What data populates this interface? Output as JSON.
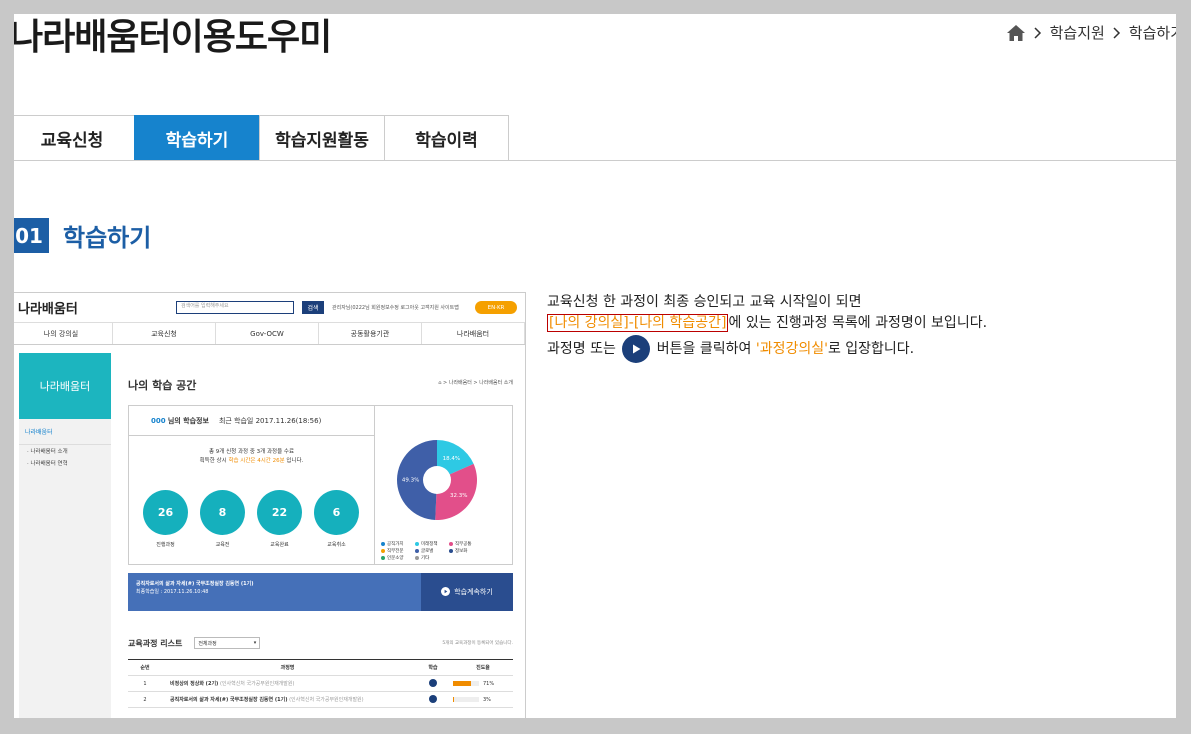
{
  "page_title": "나라배움터이용도우미",
  "breadcrumb": [
    "학습지원",
    "학습하기"
  ],
  "tabs": [
    {
      "label": "교육신청",
      "active": false
    },
    {
      "label": "학습하기",
      "active": true
    },
    {
      "label": "학습지원활동",
      "active": false
    },
    {
      "label": "학습이력",
      "active": false
    }
  ],
  "section": {
    "number": "01",
    "title": "학습하기"
  },
  "description": {
    "line1": "교육신청 한 과정이 최종 승인되고 교육 시작일이 되면",
    "line2_highlight": "[나의 강의실]-[나의 학습공간]",
    "line2_rest": "에 있는 진행과정 목록에 과정명이 보입니다.",
    "line3_a": "과정명 또는",
    "line3_b": "버튼을 클릭하여",
    "line3_highlight": "'과정강의실'",
    "line3_c": "로 입장합니다."
  },
  "shot": {
    "logo": "나라배움터",
    "search_placeholder": "검색어를 입력해주세요",
    "search_button": "검색",
    "top_links": "관리자님(0222님 회원정보수정 로그아웃 고객지원 사이트맵",
    "en_button": "EN·KR",
    "gnb": [
      "나의 강의실",
      "교육신청",
      "Gov-OCW",
      "공동활용기관",
      "나라배움터"
    ],
    "side_head": "나라배움터",
    "side_item": "나라배움터",
    "side_subs": [
      "· 나라배움터 소개",
      "· 나라배움터 연혁"
    ],
    "heading": "나의 학습 공간",
    "breadcrumb": "⌂ > 나라배움터 > 나라배움터 소개",
    "info_name": "000",
    "info_title": "님의 학습정보",
    "info_last": "최근 학습일 2017.11.26(18:56)",
    "summary1": "총 9개 신청 과정 중 3개 과정을 수료",
    "summary2a": "획득한 상시",
    "summary2b": "학습 시간은 4시간 26분",
    "summary2c": "입니다.",
    "circles": [
      {
        "value": "26",
        "label": "진행과정"
      },
      {
        "value": "8",
        "label": "교육전"
      },
      {
        "value": "22",
        "label": "교육완료"
      },
      {
        "value": "6",
        "label": "교육취소"
      }
    ],
    "pie": [
      {
        "label": "49.3%",
        "value": 49.3,
        "color": "#3f5fa8"
      },
      {
        "label": "32.3%",
        "value": 32.3,
        "color": "#e24f8a"
      },
      {
        "label": "18.4%",
        "value": 18.4,
        "color": "#2ec9e4"
      }
    ],
    "legend": [
      {
        "label": "공직가치",
        "color": "#1683cd"
      },
      {
        "label": "미래정책",
        "color": "#2ec9e4"
      },
      {
        "label": "직무공통",
        "color": "#e24f8a"
      },
      {
        "label": "직무전문",
        "color": "#f5a000"
      },
      {
        "label": "글로벌",
        "color": "#3f5fa8"
      },
      {
        "label": "정보화",
        "color": "#2a4d8f"
      },
      {
        "label": "인문소양",
        "color": "#29a36a"
      },
      {
        "label": "기타",
        "color": "#999999"
      }
    ],
    "bar_title": "공직자로서의 삶과 자세(#) 국무조정실장 김동연 (1기)",
    "bar_sub": "최종학습일 : 2017.11.26.10:48",
    "bar_button": "학습계속하기",
    "list_title": "교육과정 리스트",
    "list_select": "전체과정",
    "list_note": "5개의 교육과정이 등록되어 있습니다.",
    "table_headers": [
      "순번",
      "과정명",
      "학습",
      "진도율"
    ],
    "rows": [
      {
        "no": "1",
        "name": "비정상의 정상화 (2기)",
        "note": "(인사혁신처 국가공무원인재개발원)",
        "progress": 71,
        "progress_label": "71%"
      },
      {
        "no": "2",
        "name": "공직자로서의 삶과 자세(#) 국무조정실장 김동연 (1기)",
        "note": "(인사혁신처 국가공무원인재개발원)",
        "progress": 3,
        "progress_label": "3%"
      }
    ]
  },
  "colors": {
    "tab_active": "#1683cd",
    "section": "#1c5ea5",
    "highlight": "#f08c00"
  }
}
